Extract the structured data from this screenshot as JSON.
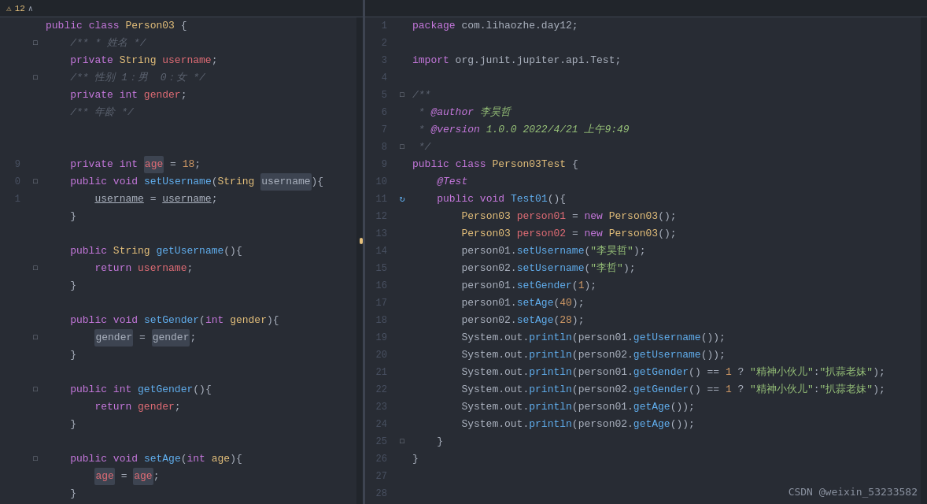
{
  "editor": {
    "left_pane": {
      "header": {
        "warning_icon": "⚠",
        "warning_count": "12",
        "chevron": "∧"
      }
    },
    "right_pane": {
      "header": {}
    },
    "watermark": "CSDN @weixin_53233582"
  }
}
